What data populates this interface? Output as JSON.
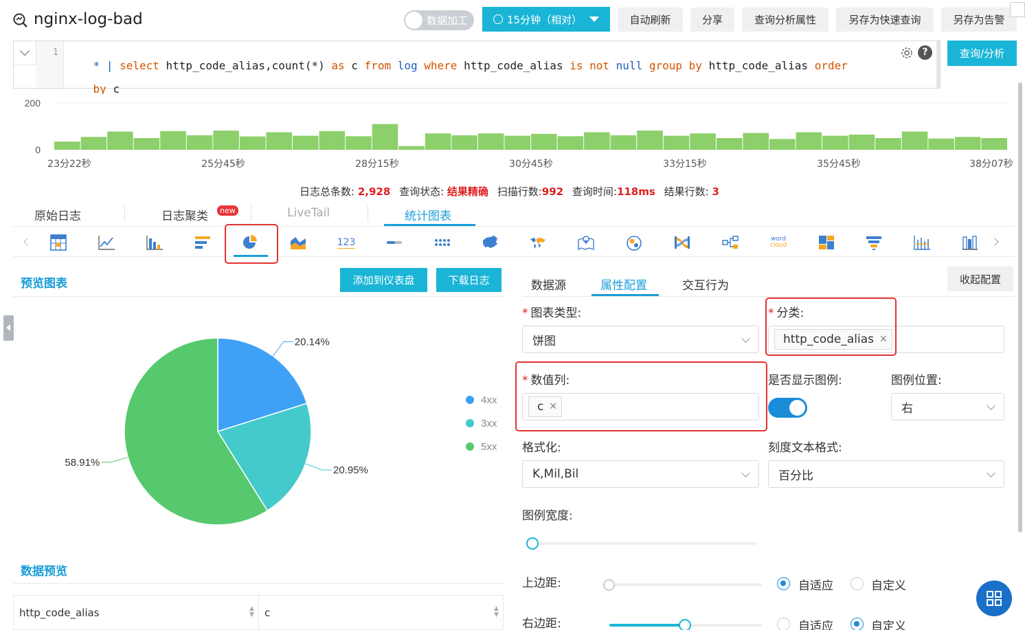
{
  "header": {
    "title": "nginx-log-bad",
    "toggle_label": "数据加工",
    "time_label": "15分钟（相对）",
    "buttons": [
      "自动刷新",
      "分享",
      "查询分析属性",
      "另存为快速查询",
      "另存为告警"
    ]
  },
  "query": {
    "line_number": "1",
    "line1_tokens": [
      "*",
      "|",
      "select",
      "http_code_alias,count(*)",
      "as",
      "c",
      "from",
      "log",
      "where",
      "http_code_alias",
      "is",
      "not",
      "null",
      "group",
      "by",
      "http_code_alias",
      "order"
    ],
    "line2_tokens": [
      "by",
      "c"
    ],
    "submit_label": "查询/分析"
  },
  "histogram": {
    "y_ticks": [
      "200",
      "0"
    ],
    "x_ticks": [
      "23分22秒",
      "25分45秒",
      "28分15秒",
      "30分45秒",
      "33分15秒",
      "35分45秒",
      "38分07秒"
    ],
    "values": [
      35,
      55,
      78,
      50,
      80,
      62,
      82,
      57,
      75,
      60,
      80,
      58,
      110,
      16,
      70,
      62,
      70,
      60,
      68,
      58,
      75,
      62,
      82,
      60,
      70,
      50,
      72,
      46,
      75,
      60,
      65,
      50,
      78,
      48,
      55,
      50
    ]
  },
  "stats": {
    "total_label": "日志总条数:",
    "total_value": "2,928",
    "status_label": "查询状态:",
    "status_value": "结果精确",
    "scan_label": "扫描行数:",
    "scan_value": "992",
    "time_label": "查询时间:",
    "time_value": "118ms",
    "rows_label": "结果行数:",
    "rows_value": "3"
  },
  "tabs": {
    "raw": "原始日志",
    "cluster": "日志聚类",
    "new_badge": "new",
    "livetail": "LiveTail",
    "chart": "统计图表"
  },
  "chart_icons": [
    "table-icon",
    "line-chart-icon",
    "bar-chart-icon",
    "horizontal-bar-icon",
    "pie-chart-icon",
    "area-chart-icon",
    "single-value-icon",
    "progress-bar-icon",
    "flow-icon",
    "china-map-icon",
    "world-map-icon",
    "gaode-map-icon",
    "bubble-map-icon",
    "sankey-icon",
    "topology-icon",
    "word-cloud-icon",
    "treemap-icon",
    "funnel-icon",
    "cross-table-icon",
    "column-icon"
  ],
  "single_value_glyph": "123",
  "word_cloud_glyph_1": "word",
  "word_cloud_glyph_2": "cloud",
  "preview": {
    "title": "预览图表",
    "add_button": "添加到仪表盘",
    "download_button": "下载日志",
    "data_preview_title": "数据预览",
    "table_headers": [
      "http_code_alias",
      "c"
    ]
  },
  "chart_data": {
    "type": "pie",
    "categories": [
      "4xx",
      "3xx",
      "5xx"
    ],
    "values": [
      20.14,
      20.95,
      58.91
    ],
    "labels": [
      "20.14%",
      "20.95%",
      "58.91%"
    ],
    "colors": [
      "#3ea1f5",
      "#44cacb",
      "#56c96f"
    ],
    "legend_position": "right"
  },
  "config": {
    "tabs": [
      "数据源",
      "属性配置",
      "交互行为"
    ],
    "collapse_button": "收起配置",
    "chart_type_label": "图表类型:",
    "chart_type_value": "饼图",
    "category_label": "分类:",
    "category_tag": "http_code_alias",
    "value_col_label": "数值列:",
    "value_col_tag": "c",
    "show_legend_label": "是否显示图例:",
    "legend_pos_label": "图例位置:",
    "legend_pos_value": "右",
    "format_label": "格式化:",
    "format_value": "K,Mil,Bil",
    "tick_format_label": "刻度文本格式:",
    "tick_format_value": "百分比",
    "legend_width_label": "图例宽度:",
    "top_margin_label": "上边距:",
    "right_margin_label": "右边距:",
    "adaptive_label": "自适应",
    "custom_label": "自定义"
  }
}
